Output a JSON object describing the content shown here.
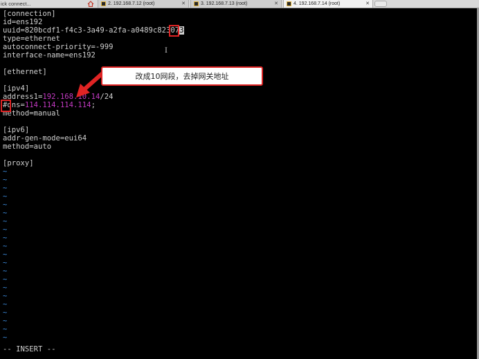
{
  "tabbar": {
    "quick_connect": "ick connect...",
    "tabs": [
      {
        "label": "2. 192.168.7.12 (root)",
        "close": "✕"
      },
      {
        "label": "3. 192.168.7.13 (root)",
        "close": "✕"
      },
      {
        "label": "4. 192.168.7.14 (root)",
        "close": "✕"
      }
    ]
  },
  "terminal": {
    "lines": {
      "l0": "[connection]",
      "l1": "id=ens192",
      "l2a": "uuid=820bcdf1-f4c3-3a49-a2fa-a0489c82307",
      "l2cursor": "3",
      "l3": "type=ethernet",
      "l4": "autoconnect-priority=-999",
      "l5": "interface-name=ens192",
      "l7": "[ethernet]",
      "l9": "[ipv4]",
      "l10a": "address1=",
      "l10ip": "192.168.10.14",
      "l10b": "/24",
      "l11a": "#dns=",
      "l11ip": "114.114.114.114",
      "l11b": ";",
      "l12": "method=manual",
      "l14": "[ipv6]",
      "l15": "addr-gen-mode=eui64",
      "l16": "method=auto",
      "l18": "[proxy]",
      "tilde": "~",
      "status": "-- INSERT --"
    }
  },
  "annotation": {
    "callout_text": "改成10网段，去掉网关地址"
  },
  "colors": {
    "ip": "#c43ac3",
    "tilde": "#3b88d8",
    "annotation": "#e02424"
  }
}
